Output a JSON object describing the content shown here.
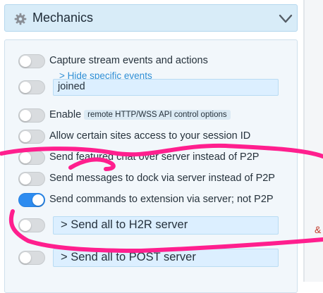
{
  "header": {
    "title": "Mechanics",
    "icon": "gear-icon",
    "expand_icon": "chevron-down-icon"
  },
  "sidebar_fragment": {
    "text": "&"
  },
  "settings": {
    "capture": {
      "label": "Capture stream events and actions",
      "on": false
    },
    "hide_events_link": "> Hide specific events",
    "filter_field": {
      "on": false,
      "value": "joined"
    },
    "enable_api": {
      "label": "Enable",
      "chip": "remote HTTP/WSS API control options",
      "on": false
    },
    "session_access": {
      "label": "Allow certain sites access to your session ID",
      "on": false
    },
    "featured_chat": {
      "label": "Send featured chat over server instead of P2P",
      "on": false
    },
    "dock_messages": {
      "label": "Send messages to dock via server instead of P2P",
      "on": false
    },
    "extension_commands": {
      "label": "Send commands to extension via server; not P2P",
      "on": true
    },
    "h2r_server": {
      "button": "> Send all to H2R server",
      "on": false
    },
    "post_server": {
      "button": "> Send all to POST server",
      "on": false
    }
  },
  "colors": {
    "accent": "#2d8cf0",
    "header_bg": "#d8ecf8",
    "field_bg": "#dcefff",
    "annotation": "#ff1f8e"
  }
}
